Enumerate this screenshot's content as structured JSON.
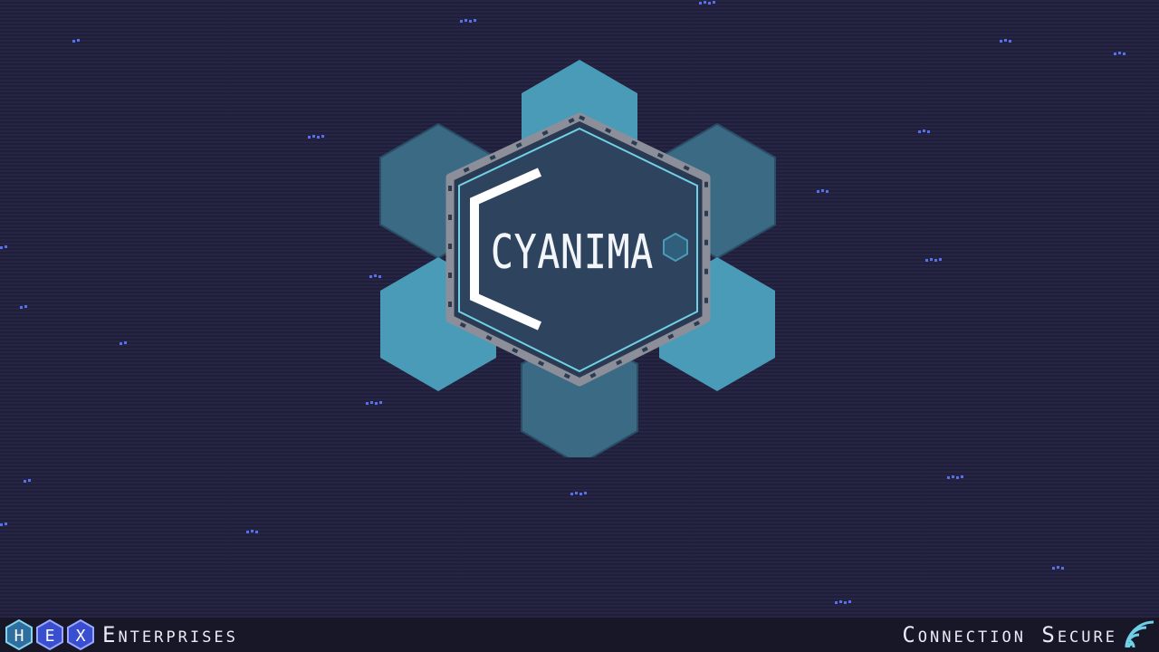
{
  "logo": {
    "title": "CYANIMA"
  },
  "footer": {
    "brand_letters": [
      "H",
      "E",
      "X"
    ],
    "brand_name": "Enterprises",
    "status": "Connection Secure"
  },
  "colors": {
    "background": "#22213f",
    "hex_light": "#4a9bb8",
    "hex_dark": "#3b6a85",
    "center_panel": "#2e4560",
    "frame_outline": "#6fd0e6",
    "particle": "#5b7bff",
    "footer_bg": "#171728",
    "text": "#e8ecf4"
  },
  "icons": {
    "status": "signal-icon"
  }
}
